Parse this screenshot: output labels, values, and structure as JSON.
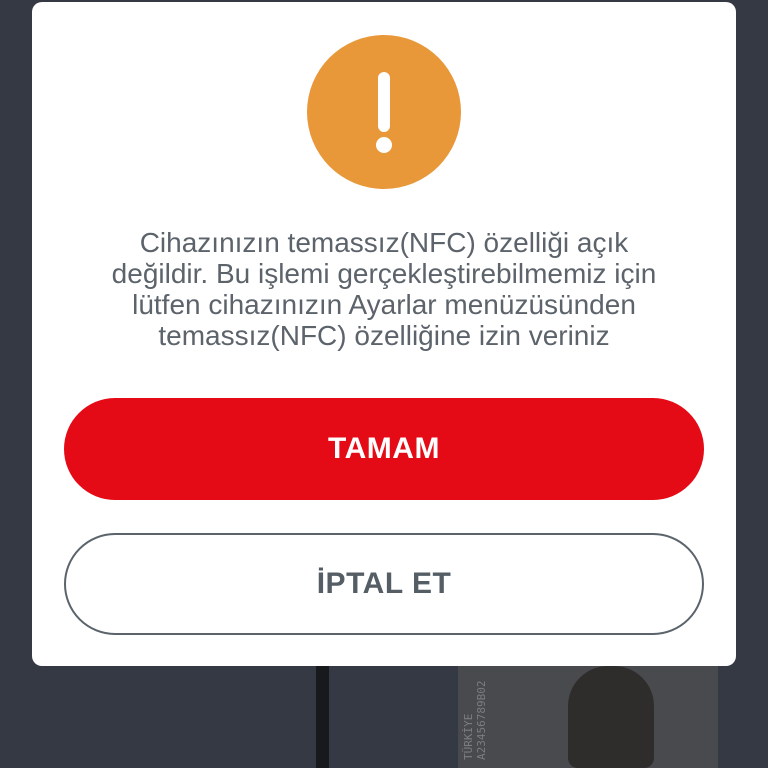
{
  "dialog": {
    "icon": "exclamation-icon",
    "icon_color": "#E89838",
    "message": "Cihazınızın temassız(NFC) özelliği açık\ndeğildir. Bu işlemi gerçekleştirebilmemiz için\nlütfen cihazınızın Ayarlar menüzüsünden\ntemassız(NFC) özelliğine izin veriniz",
    "primary_button": "TAMAM",
    "secondary_button": "İPTAL ET",
    "primary_color": "#E40B17"
  },
  "background": {
    "card_text": "TÜRKİYE  A23456789B02"
  }
}
